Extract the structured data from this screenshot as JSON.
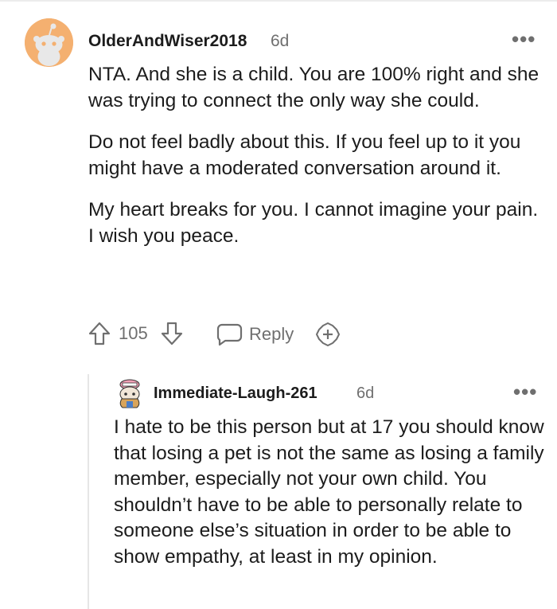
{
  "comments": [
    {
      "author": "OlderAndWiser2018",
      "time": "6d",
      "avatar_icon": "snoo-avatar-icon",
      "avatar_color": "#f4b070",
      "paragraphs": [
        "NTA. And she is a child. You are 100% right and she was trying to connect the only way she could.",
        "Do not feel badly about this. If you feel up to it you might have a moderated conversation around it.",
        "My heart breaks for you. I cannot imagine your pain. I wish you peace."
      ],
      "votes": "105",
      "reply_label": "Reply",
      "more_label": "•••"
    },
    {
      "author": "Immediate-Laugh-261",
      "time": "6d",
      "avatar_icon": "snoo-avatar-icon",
      "paragraphs": [
        "I hate to be this person but at 17 you should know that losing a pet is not the same as losing a family member, especially not your own child. You shouldn’t have to be able to personally relate to someone else’s situation in order to be able to show empathy, at least in my opinion."
      ],
      "more_label": "•••"
    }
  ],
  "icons": {
    "upvote": "upvote-arrow-icon",
    "downvote": "downvote-arrow-icon",
    "reply": "speech-bubble-icon",
    "award": "award-plus-icon",
    "more": "more-options-icon"
  },
  "colors": {
    "text": "#1c1c1c",
    "meta": "#6f6f6f",
    "thread_line": "#e6e6e6"
  }
}
